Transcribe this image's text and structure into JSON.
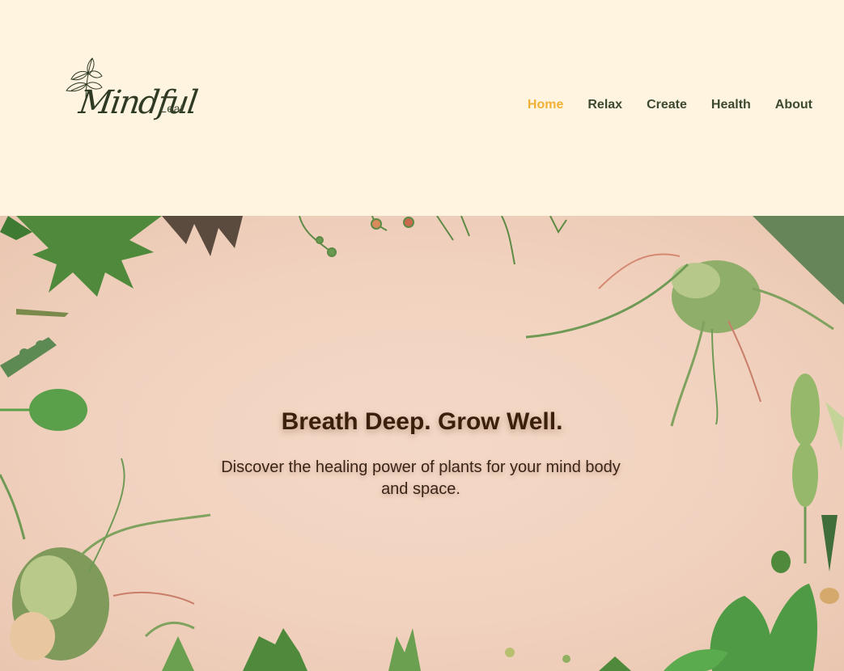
{
  "brand": {
    "script": "Mindful",
    "small": "Leaf"
  },
  "nav": {
    "items": [
      {
        "label": "Home",
        "active": true
      },
      {
        "label": "Relax",
        "active": false
      },
      {
        "label": "Create",
        "active": false
      },
      {
        "label": "Health",
        "active": false
      },
      {
        "label": "About",
        "active": false
      }
    ]
  },
  "hero": {
    "title": "Breath Deep. Grow Well.",
    "subtitle": "Discover the healing power of plants for your mind body and space."
  },
  "colors": {
    "header_bg": "#fff4df",
    "accent": "#f0b135",
    "nav_text": "#3d4a2f",
    "hero_bg": "#f1d2bf",
    "title_text": "#3a1f0c"
  }
}
